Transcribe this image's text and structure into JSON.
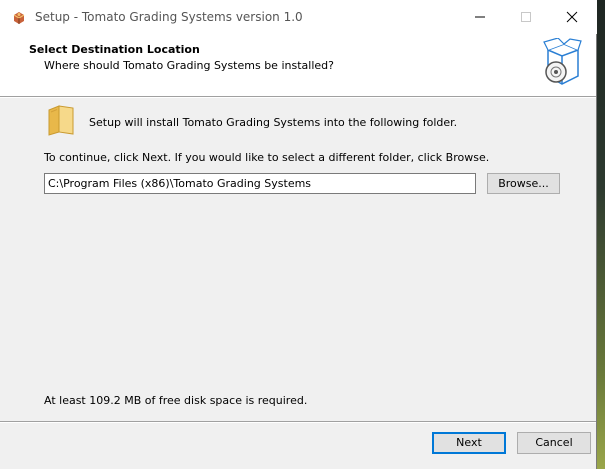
{
  "window": {
    "title": "Setup - Tomato Grading Systems version 1.0"
  },
  "header": {
    "title": "Select Destination Location",
    "subtitle": "Where should Tomato Grading Systems be installed?"
  },
  "body": {
    "intro_text": "Setup will install Tomato Grading Systems into the following folder.",
    "continue_text": "To continue, click Next. If you would like to select a different folder, click Browse.",
    "install_path": "C:\\Program Files (x86)\\Tomato Grading Systems",
    "browse_label": "Browse...",
    "disk_space_text": "At least 109.2 MB of free disk space is required."
  },
  "footer": {
    "next_label": "Next",
    "cancel_label": "Cancel"
  },
  "icons": {
    "app": "installer-app-icon",
    "minimize": "minimize-icon",
    "maximize": "maximize-icon",
    "close": "close-icon",
    "header": "software-box-disc-icon",
    "folder": "folder-icon"
  },
  "colors": {
    "accent": "#0078d7",
    "window_bg": "#f0f0f0",
    "header_bg": "#ffffff"
  }
}
